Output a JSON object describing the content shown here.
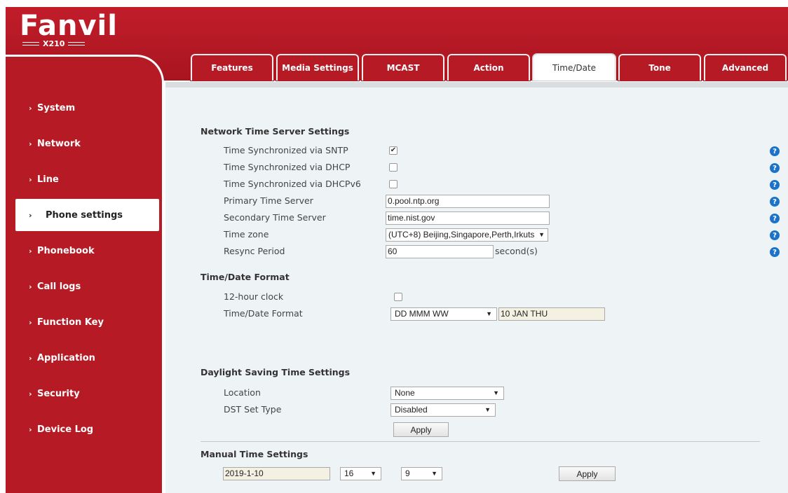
{
  "brand": {
    "logo": "Fanvil",
    "model": "X210"
  },
  "sidebar": {
    "items": [
      {
        "label": "System"
      },
      {
        "label": "Network"
      },
      {
        "label": "Line"
      },
      {
        "label": "Phone settings"
      },
      {
        "label": "Phonebook"
      },
      {
        "label": "Call logs"
      },
      {
        "label": "Function Key"
      },
      {
        "label": "Application"
      },
      {
        "label": "Security"
      },
      {
        "label": "Device Log"
      }
    ],
    "active": "Phone settings"
  },
  "tabs": [
    {
      "label": "Features"
    },
    {
      "label": "Media Settings"
    },
    {
      "label": "MCAST"
    },
    {
      "label": "Action"
    },
    {
      "label": "Time/Date"
    },
    {
      "label": "Tone"
    },
    {
      "label": "Advanced"
    }
  ],
  "active_tab": "Time/Date",
  "network_time": {
    "title": "Network Time Server Settings",
    "sntp_label": "Time Synchronized via SNTP",
    "sntp_checked": true,
    "dhcp_label": "Time Synchronized via DHCP",
    "dhcp_checked": false,
    "dhcpv6_label": "Time Synchronized via DHCPv6",
    "dhcpv6_checked": false,
    "primary_label": "Primary Time Server",
    "primary_value": "0.pool.ntp.org",
    "secondary_label": "Secondary Time Server",
    "secondary_value": "time.nist.gov",
    "timezone_label": "Time zone",
    "timezone_value": "(UTC+8) Beijing,Singapore,Perth,Irkuts",
    "resync_label": "Resync Period",
    "resync_value": "60",
    "resync_unit": "second(s)"
  },
  "time_format": {
    "title": "Time/Date Format",
    "clock12_label": "12-hour clock",
    "clock12_checked": false,
    "format_label": "Time/Date Format",
    "format_value": "DD MMM WW",
    "preview_value": "10 JAN THU"
  },
  "dst": {
    "title": "Daylight Saving Time Settings",
    "location_label": "Location",
    "location_value": "None",
    "type_label": "DST Set Type",
    "type_value": "Disabled",
    "apply_label": "Apply"
  },
  "manual_time": {
    "title": "Manual Time Settings",
    "date_value": "2019-1-10",
    "hour_value": "16",
    "minute_value": "9",
    "apply_label": "Apply"
  },
  "help_glyph": "?",
  "check_glyph": "✔",
  "arrow_glyph": "▼",
  "chevron_glyph": "›"
}
